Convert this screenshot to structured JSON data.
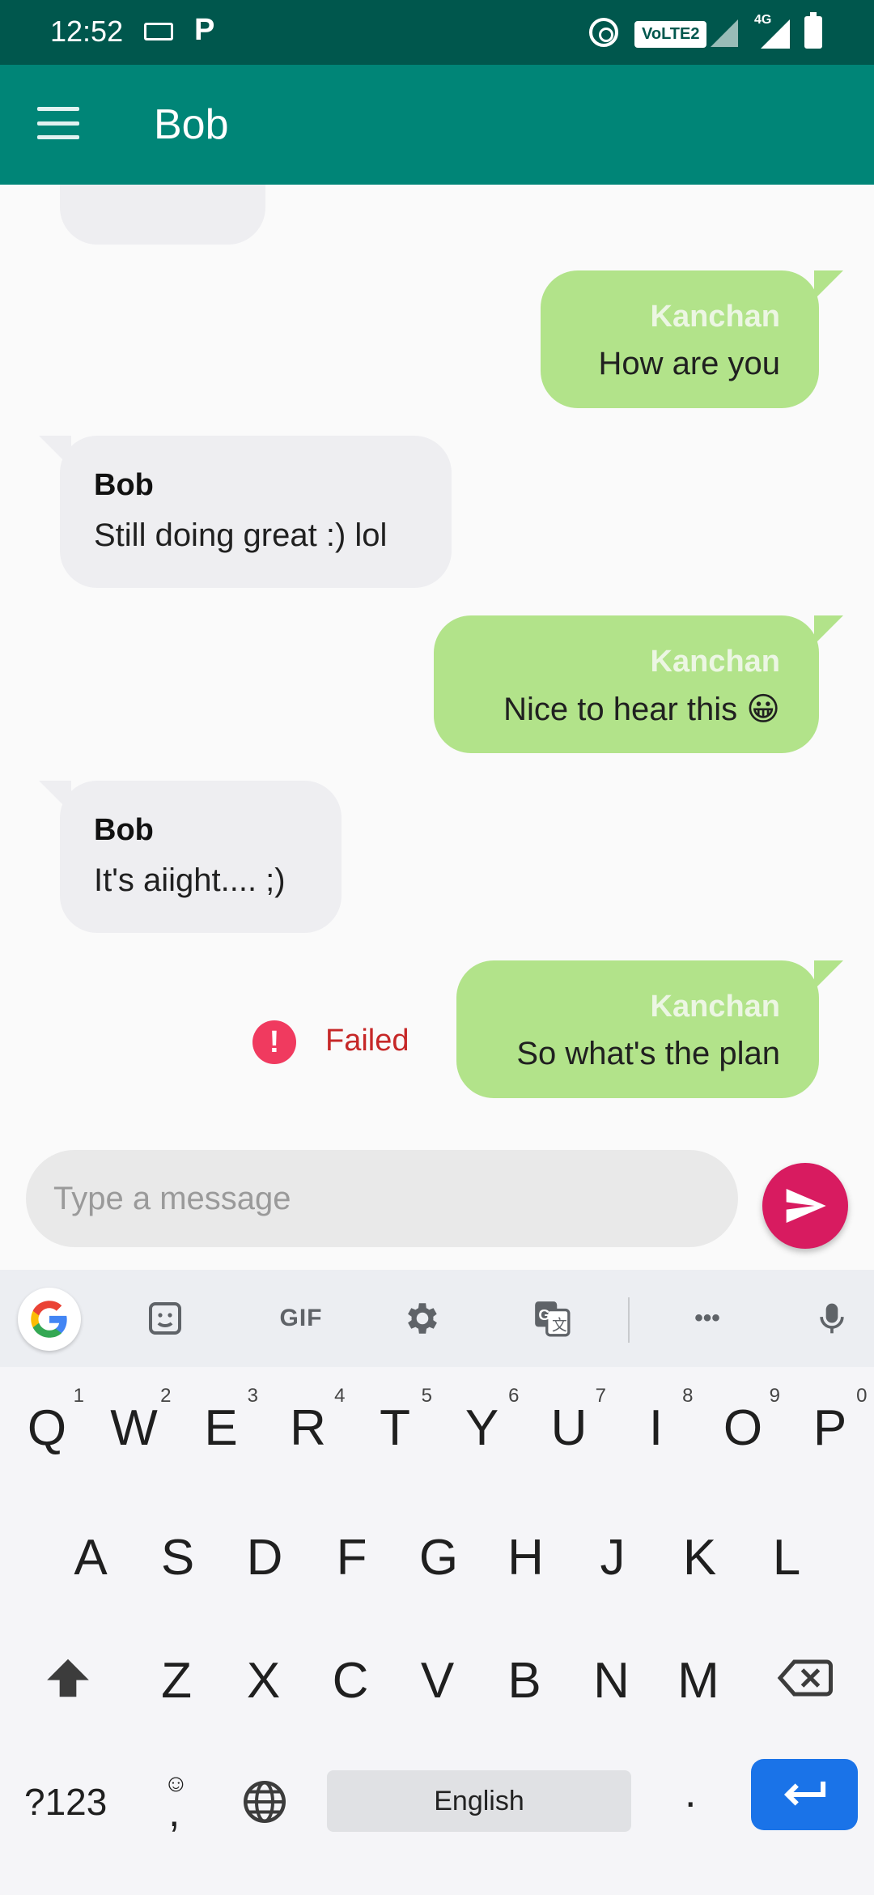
{
  "status_bar": {
    "time": "12:52",
    "carrier_badge": "VoLTE2",
    "network_type": "4G"
  },
  "app_bar": {
    "title": "Bob"
  },
  "messages": [
    {
      "direction": "received",
      "sender": "Bob",
      "text": "Still doing great :) lol"
    },
    {
      "direction": "sent",
      "sender": "Kanchan",
      "text": "How are you"
    },
    {
      "direction": "sent",
      "sender": "Kanchan",
      "text": "Nice to hear this 😀"
    },
    {
      "direction": "received",
      "sender": "Bob",
      "text": "It's aiight.... ;)"
    },
    {
      "direction": "sent",
      "sender": "Kanchan",
      "text": "So what's the plan",
      "status": "Failed"
    }
  ],
  "composer": {
    "placeholder": "Type a message",
    "value": ""
  },
  "keyboard": {
    "toolbar": {
      "gif_label": "GIF",
      "more_label": "•••"
    },
    "rows": [
      [
        {
          "k": "Q",
          "hint": "1"
        },
        {
          "k": "W",
          "hint": "2"
        },
        {
          "k": "E",
          "hint": "3"
        },
        {
          "k": "R",
          "hint": "4"
        },
        {
          "k": "T",
          "hint": "5"
        },
        {
          "k": "Y",
          "hint": "6"
        },
        {
          "k": "U",
          "hint": "7"
        },
        {
          "k": "I",
          "hint": "8"
        },
        {
          "k": "O",
          "hint": "9"
        },
        {
          "k": "P",
          "hint": "0"
        }
      ],
      [
        {
          "k": "A"
        },
        {
          "k": "S"
        },
        {
          "k": "D"
        },
        {
          "k": "F"
        },
        {
          "k": "G"
        },
        {
          "k": "H"
        },
        {
          "k": "J"
        },
        {
          "k": "K"
        },
        {
          "k": "L"
        }
      ],
      [
        {
          "k": "Z"
        },
        {
          "k": "X"
        },
        {
          "k": "C"
        },
        {
          "k": "V"
        },
        {
          "k": "B"
        },
        {
          "k": "N"
        },
        {
          "k": "M"
        }
      ]
    ],
    "symbols_label": "?123",
    "comma_label": ",",
    "emoji_hint": "☺",
    "space_label": "English",
    "period_label": "."
  },
  "colors": {
    "status_bar": "#00574d",
    "app_bar": "#008577",
    "sent_bubble": "#b2e38a",
    "received_bubble": "#eeeef1",
    "send_button": "#d81b60",
    "failed": "#c62828",
    "enter_key": "#1a73e8"
  }
}
